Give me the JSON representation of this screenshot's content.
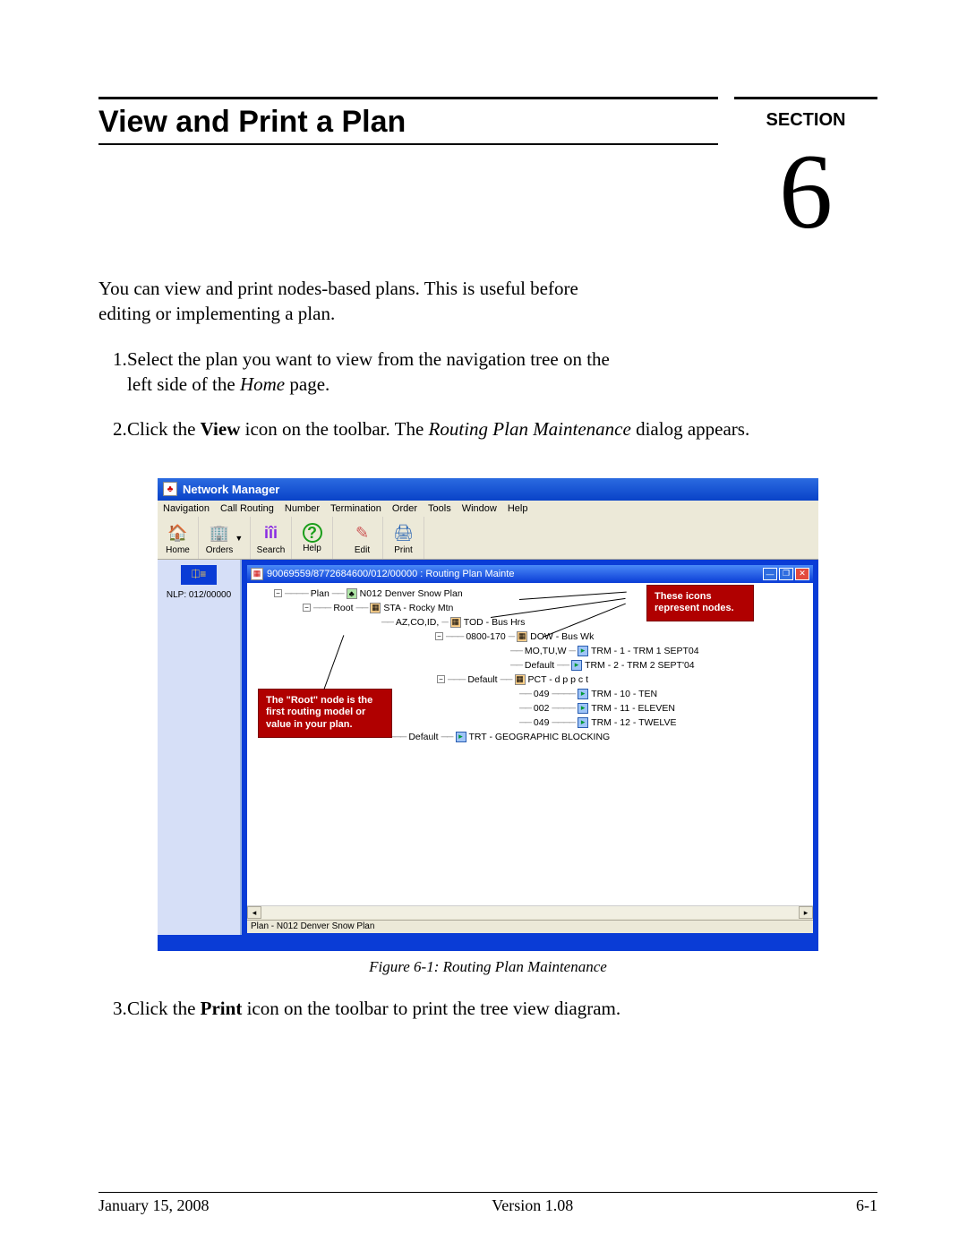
{
  "doc": {
    "title": "View and Print a Plan",
    "section_label": "SECTION",
    "section_number": "6",
    "intro": "You can view and print nodes-based plans. This is useful before editing or implementing a plan.",
    "step1_num": "1.",
    "step1a": "Select the plan you want to view from the navigation tree on the left side of the ",
    "step1_em": "Home",
    "step1b": " page.",
    "step2_num": "2.",
    "step2a": "Click the ",
    "step2_bold": "View",
    "step2b": " icon on the toolbar. The ",
    "step2_em": "Routing Plan Maintenance",
    "step2c": " dialog appears.",
    "step3_num": "3.",
    "step3a": "Click the ",
    "step3_bold": "Print",
    "step3b": " icon on the toolbar to print the tree view diagram.",
    "caption": "Figure 6-1:   Routing Plan Maintenance",
    "footer_left": "January 15, 2008",
    "footer_center": "Version 1.08",
    "footer_right": "6-1"
  },
  "app": {
    "title": "Network Manager",
    "icon_glyph": "♣",
    "left_label": "NLP: 012/00000",
    "status": "Plan - N012   Denver Snow Plan",
    "inner_title": "90069559/8772684600/012/00000 : Routing Plan Mainte",
    "menus": [
      "Navigation",
      "Call Routing",
      "Number",
      "Termination",
      "Order",
      "Tools",
      "Window",
      "Help"
    ],
    "tools": [
      {
        "label": "Home",
        "glyph": "🏠",
        "color": "#c97f1d"
      },
      {
        "label": "Orders",
        "glyph": "🏢",
        "color": "#3a7bd5",
        "drop": true
      },
      {
        "label": "Search",
        "glyph": "🔎",
        "color": "#8a2be2"
      },
      {
        "label": "Help",
        "glyph": "?",
        "color": "#1a9e1a"
      },
      {
        "label": "Edit",
        "glyph": "✎",
        "color": "#3a7bd5"
      },
      {
        "label": "Print",
        "glyph": "🖨",
        "color": "#1a9e1a"
      }
    ],
    "callout_a": "These icons represent nodes.",
    "callout_b": "The \"Root\" node is the first routing model or value in your plan.",
    "tree": {
      "r0": "Plan",
      "r0b": "N012  Denver Snow Plan",
      "r1": "Root",
      "r1b": "STA - Rocky Mtn",
      "r2": "AZ,CO,ID,",
      "r2b": "TOD - Bus Hrs",
      "r3": "0800-170",
      "r3b": "DOW - Bus Wk",
      "r4": "MO,TU,W",
      "r4b": "TRM - 1 - TRM 1 SEPT04",
      "r5": "Default",
      "r5b": "TRM - 2 - TRM 2 SEPT'04",
      "r6": "Default",
      "r6b": "PCT - d p p c t",
      "r7": "049",
      "r7b": "TRM - 10 - TEN",
      "r8": "002",
      "r8b": "TRM - 11 - ELEVEN",
      "r9": "049",
      "r9b": "TRM - 12 - TWELVE",
      "r10": "Default",
      "r10b": "TRT - GEOGRAPHIC BLOCKING"
    }
  }
}
